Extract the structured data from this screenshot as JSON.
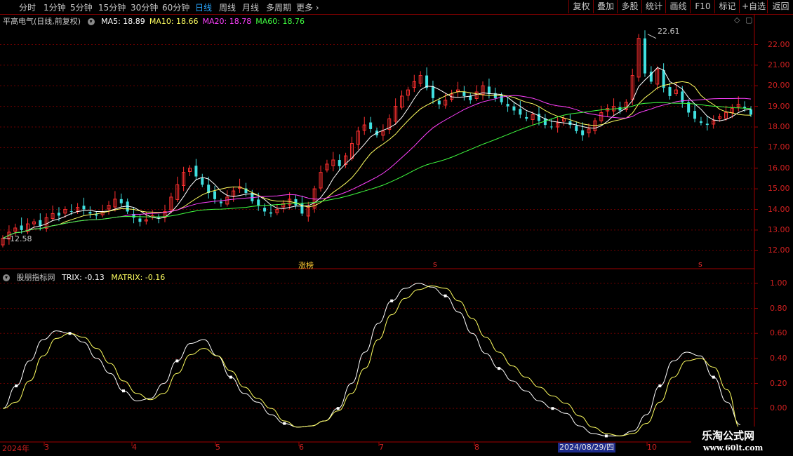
{
  "toolbar": {
    "timeframes": [
      "分时",
      "1分钟",
      "5分钟",
      "15分钟",
      "30分钟",
      "60分钟",
      "日线",
      "周线",
      "月线",
      "多周期",
      "更多"
    ],
    "active": "日线",
    "right_buttons": [
      "复权",
      "叠加",
      "多股",
      "统计",
      "画线",
      "F10",
      "标记",
      "+自选",
      "返回"
    ]
  },
  "main_legend": {
    "title": "平高电气(日线,前复权)",
    "ma": [
      {
        "label": "MA5: 18.89",
        "color": "#ffffff"
      },
      {
        "label": "MA10: 18.66",
        "color": "#ffff60"
      },
      {
        "label": "MA20: 18.78",
        "color": "#ff40ff"
      },
      {
        "label": "MA60: 18.76",
        "color": "#40ff40"
      }
    ]
  },
  "sub_legend": {
    "title": "股朋指标网",
    "trix": "TRIX: -0.13",
    "matrix": "MATRIX: -0.16"
  },
  "price_axis": [
    "22.00",
    "21.00",
    "20.00",
    "19.00",
    "18.00",
    "17.00",
    "16.00",
    "15.00",
    "14.00",
    "13.00",
    "12.00"
  ],
  "indicator_axis": [
    "1.00",
    "0.80",
    "0.60",
    "0.40",
    "0.20",
    "0.00"
  ],
  "x_axis": [
    "2024年",
    "3",
    "4",
    "5",
    "6",
    "7",
    "8",
    "9",
    "10"
  ],
  "date_tip": "2024/08/29/四",
  "annotations": {
    "high": "22.61",
    "low": "12.58",
    "tag": "涨榜",
    "s_marker": "s"
  },
  "watermark": {
    "line1": "乐淘公式网",
    "line2": "www.60lt.com"
  },
  "chart_data": {
    "type": "line",
    "price_candles_close": [
      12.6,
      12.9,
      13.1,
      13.0,
      13.3,
      13.4,
      13.2,
      13.6,
      13.8,
      13.7,
      14.0,
      13.9,
      14.1,
      14.0,
      13.8,
      13.7,
      13.9,
      14.2,
      14.5,
      14.3,
      13.9,
      13.6,
      13.4,
      13.5,
      13.7,
      13.6,
      13.9,
      14.6,
      15.2,
      15.8,
      16.0,
      15.6,
      15.2,
      14.8,
      14.5,
      14.3,
      14.6,
      14.9,
      15.1,
      14.8,
      14.4,
      14.2,
      13.9,
      13.8,
      14.0,
      14.3,
      14.5,
      14.2,
      13.8,
      14.1,
      15.0,
      15.8,
      16.2,
      16.4,
      16.1,
      16.6,
      17.2,
      17.8,
      18.1,
      17.9,
      17.6,
      17.8,
      18.4,
      19.0,
      19.5,
      19.8,
      20.2,
      20.5,
      19.9,
      19.4,
      19.1,
      19.3,
      19.6,
      19.8,
      19.5,
      19.3,
      19.7,
      20.0,
      19.6,
      19.4,
      19.2,
      19.0,
      18.8,
      18.6,
      18.4,
      18.6,
      18.3,
      18.1,
      18.0,
      18.2,
      18.4,
      18.1,
      17.8,
      17.6,
      17.9,
      18.3,
      18.7,
      18.9,
      19.0,
      18.8,
      19.2,
      20.5,
      22.3,
      20.6,
      20.2,
      20.8,
      19.9,
      19.5,
      19.8,
      19.2,
      18.7,
      18.4,
      18.2,
      18.1,
      18.3,
      18.5,
      18.7,
      18.9,
      19.1,
      18.9,
      18.6
    ],
    "series": [
      {
        "name": "TRIX",
        "color": "#ffffff",
        "values": [
          0.0,
          0.18,
          0.38,
          0.55,
          0.62,
          0.6,
          0.53,
          0.4,
          0.28,
          0.14,
          0.06,
          0.08,
          0.2,
          0.38,
          0.52,
          0.55,
          0.42,
          0.25,
          0.12,
          0.05,
          -0.05,
          -0.12,
          -0.15,
          -0.14,
          -0.1,
          0.0,
          0.2,
          0.45,
          0.68,
          0.86,
          0.96,
          1.0,
          0.97,
          0.9,
          0.77,
          0.6,
          0.44,
          0.32,
          0.22,
          0.14,
          0.06,
          0.0,
          -0.04,
          -0.14,
          -0.2,
          -0.22,
          -0.22,
          -0.18,
          -0.05,
          0.18,
          0.38,
          0.45,
          0.42,
          0.25,
          0.05,
          -0.13
        ]
      },
      {
        "name": "MATRIX",
        "color": "#ffff60",
        "values": [
          0.0,
          0.05,
          0.22,
          0.42,
          0.56,
          0.6,
          0.57,
          0.48,
          0.36,
          0.22,
          0.12,
          0.07,
          0.12,
          0.28,
          0.43,
          0.48,
          0.42,
          0.3,
          0.17,
          0.08,
          0.0,
          -0.1,
          -0.15,
          -0.14,
          -0.1,
          -0.02,
          0.12,
          0.32,
          0.55,
          0.75,
          0.88,
          0.95,
          0.98,
          0.96,
          0.86,
          0.72,
          0.57,
          0.45,
          0.34,
          0.25,
          0.17,
          0.1,
          0.04,
          -0.06,
          -0.15,
          -0.2,
          -0.22,
          -0.2,
          -0.12,
          0.05,
          0.25,
          0.38,
          0.4,
          0.33,
          0.15,
          -0.16
        ]
      }
    ],
    "price_ylim": [
      11.5,
      22.8
    ],
    "indicator_ylim": [
      -0.1,
      1.05
    ]
  }
}
